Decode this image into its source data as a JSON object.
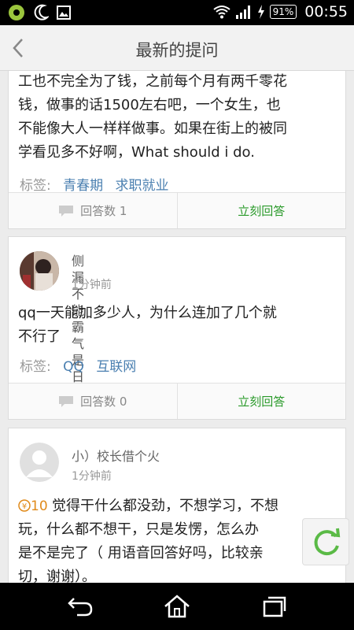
{
  "status_bar": {
    "battery": "91%",
    "time": "00:55"
  },
  "header": {
    "title": "最新的提问"
  },
  "cards": [
    {
      "text_lines": [
        "工也不完全为了钱，之前每个月有两千零花",
        "钱，做事的话1500左右吧，一个女生，也",
        "不能像大人一样样做事。如果在街上的被同",
        "学看见多不好啊，What should i do."
      ],
      "tags_label": "标签:",
      "tags": [
        "青春期",
        "求职就业"
      ],
      "answers": "回答数 1",
      "answer_action": "立刻回答"
    },
    {
      "username_chars": [
        "侧",
        "漏",
        "不",
        "能",
        "霸",
        "气",
        "是",
        "日"
      ],
      "time": "1分钟前",
      "text_lines": [
        "qq一天能加多少人，为什么连加了几个就",
        "不行了"
      ],
      "tags_label": "标签:",
      "tags": [
        "QQ",
        "互联网"
      ],
      "answers": "回答数 0",
      "answer_action": "立刻回答"
    },
    {
      "username": "小）校长借个火",
      "time": "1分钟前",
      "reward": "10",
      "text_lines": [
        "觉得干什么都没劲，不想学习，不想",
        "玩，什么都不想干，只是发愣，怎么办",
        "是不是完了（ 用语音回答好吗，比较亲",
        "切，谢谢）。"
      ]
    }
  ],
  "colors": {
    "accent_green": "#2a9a2a",
    "tag_blue": "#4a7fb0",
    "reward_orange": "#e08a1a"
  }
}
